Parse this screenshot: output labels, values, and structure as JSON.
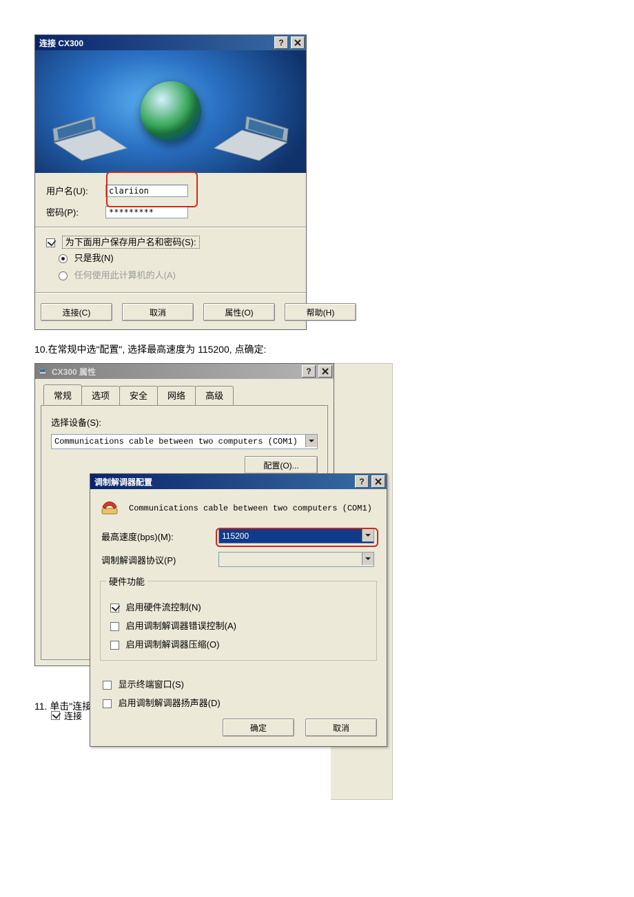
{
  "dialog1": {
    "title": "连接 CX300",
    "username_label": "用户名(U):",
    "username_value": "clariion",
    "password_label": "密码(P):",
    "password_value": "*********",
    "save_creds_label": "为下面用户保存用户名和密码(S):",
    "only_me": "只是我(N)",
    "anyone": "任何使用此计算机的人(A)",
    "buttons": {
      "connect": "连接(C)",
      "cancel": "取消",
      "props": "属性(O)",
      "help": "帮助(H)"
    }
  },
  "step10": "10.在常规中选\"配置\", 选择最高速度为 115200, 点确定:",
  "props": {
    "title": "CX300 属性",
    "tabs": [
      "常规",
      "选项",
      "安全",
      "网络",
      "高级"
    ],
    "select_device": "选择设备(S):",
    "device": "Communications cable between two computers (COM1)",
    "configure": "配置(O)...",
    "connect_check": "连接"
  },
  "modem": {
    "title": "调制解调器配置",
    "device": "Communications cable between two computers (COM1)",
    "max_speed_label": "最高速度(bps)(M):",
    "max_speed_value": "115200",
    "protocol_label": "调制解调器协议(P)",
    "protocol_value": "",
    "hw_group": "硬件功能",
    "hw_flow": "启用硬件流控制(N)",
    "err_ctrl": "启用调制解调器错误控制(A)",
    "compress": "启用调制解调器压缩(O)",
    "show_term": "显示终端窗口(S)",
    "speaker": "启用调制解调器扬声器(D)",
    "ok": "确定",
    "cancel": "取消"
  },
  "step11": "11.  单击\"连接\":",
  "chart_data": null
}
